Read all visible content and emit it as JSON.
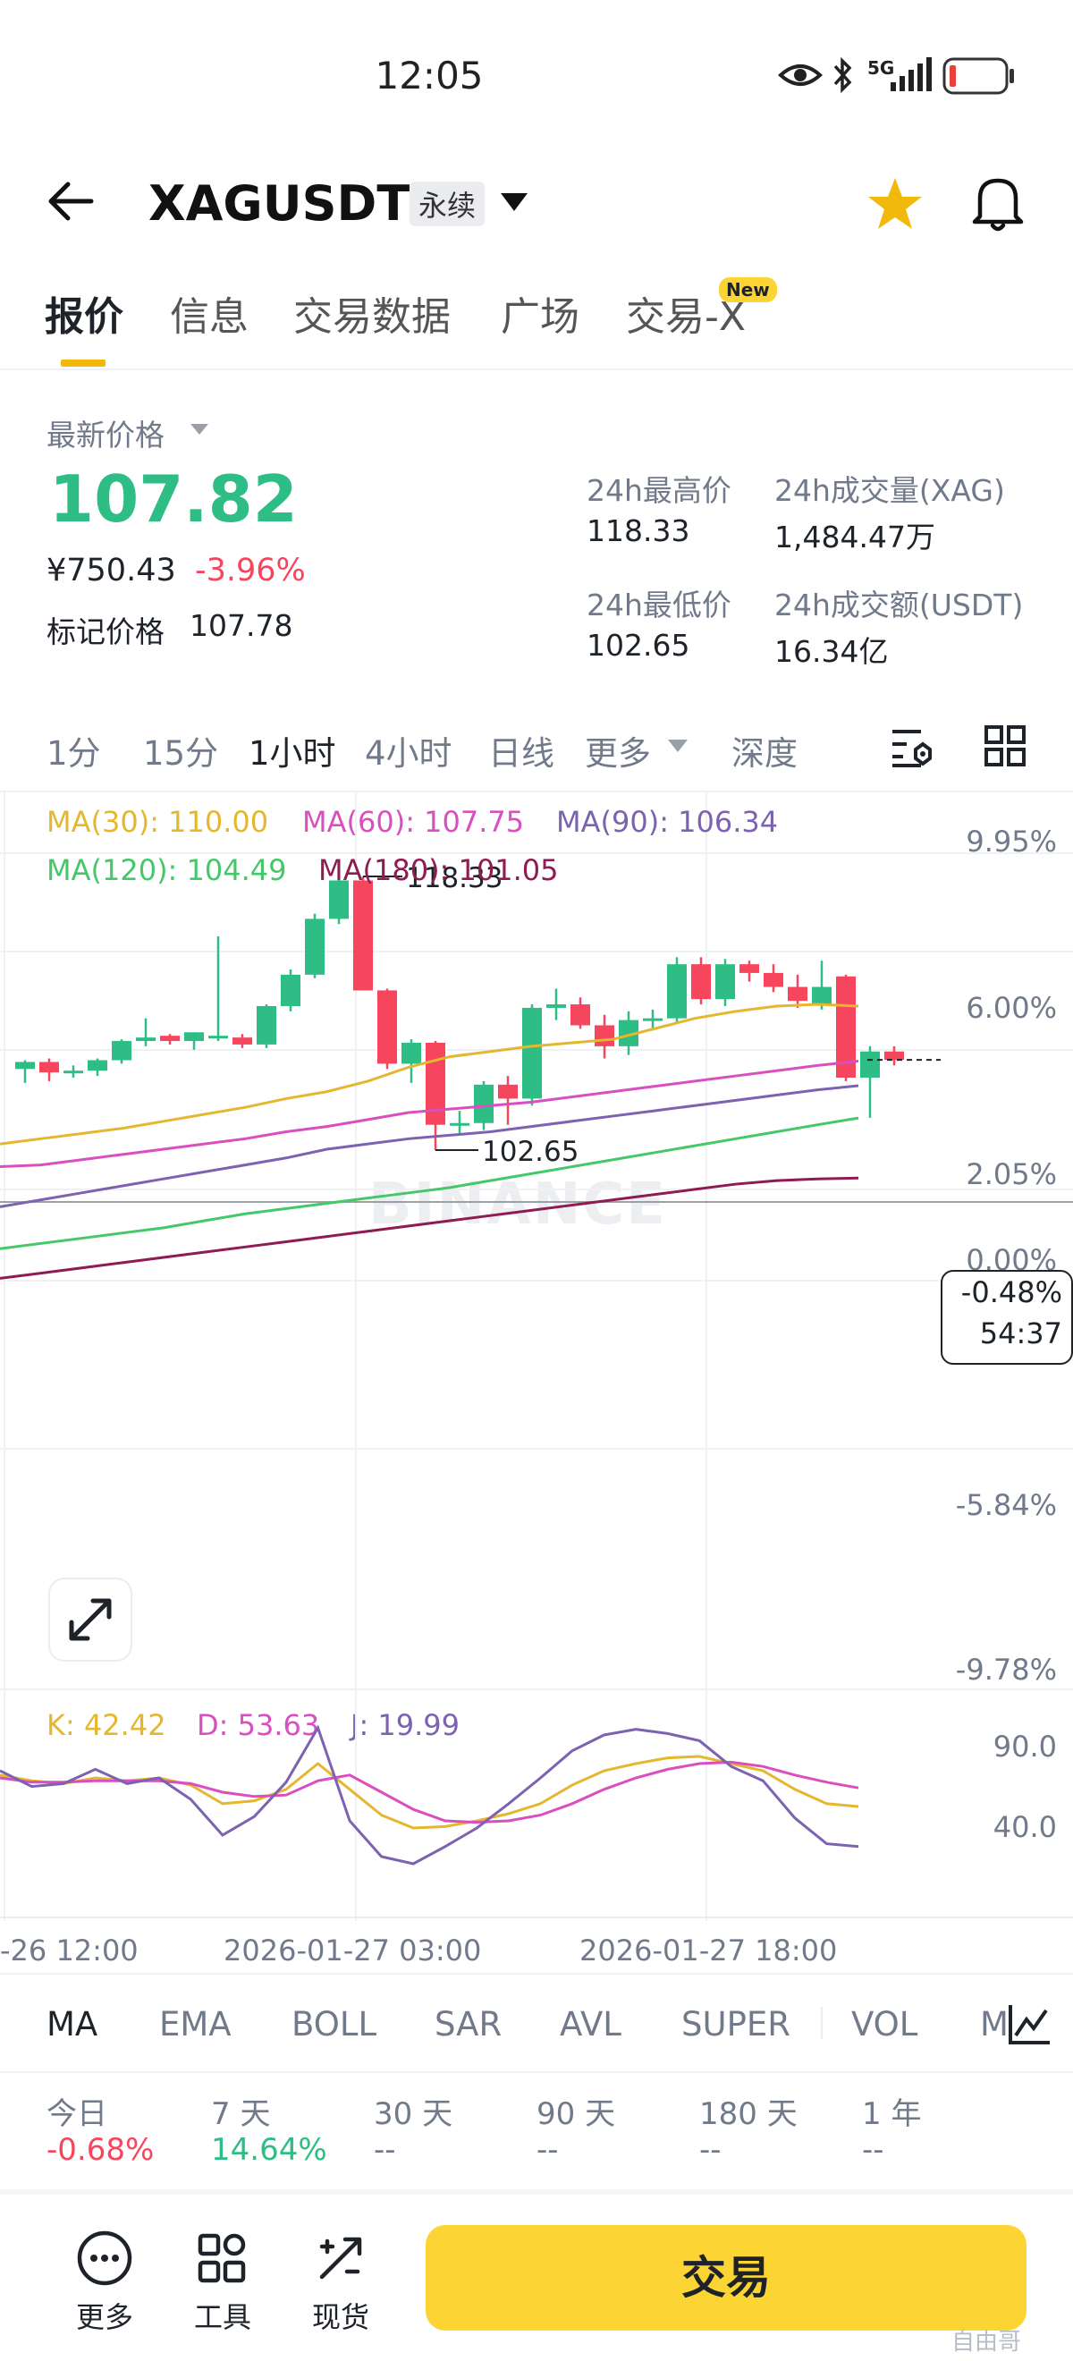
{
  "status_bar": {
    "time": "12:05",
    "network": "5G"
  },
  "header": {
    "symbol": "XAGUSDT",
    "contract_type": "永续"
  },
  "tabs": [
    {
      "label": "报价",
      "active": true
    },
    {
      "label": "信息"
    },
    {
      "label": "交易数据"
    },
    {
      "label": "广场"
    },
    {
      "label": "交易-X",
      "badge": "New"
    }
  ],
  "price": {
    "label": "最新价格",
    "last": "107.82",
    "cny": "¥750.43",
    "change_pct": "-3.96%",
    "mark_label": "标记价格",
    "mark_value": "107.78"
  },
  "stats": {
    "high_label": "24h最高价",
    "high": "118.33",
    "vol_label": "24h成交量(XAG)",
    "vol": "1,484.47万",
    "low_label": "24h最低价",
    "low": "102.65",
    "turnover_label": "24h成交额(USDT)",
    "turnover": "16.34亿"
  },
  "intervals": [
    "1分",
    "15分",
    "1小时",
    "4小时",
    "日线",
    "更多",
    "深度"
  ],
  "active_interval": "1小时",
  "ma_legend": {
    "ma30": "MA(30): 110.00",
    "ma60": "MA(60): 107.75",
    "ma90": "MA(90): 106.34",
    "ma120": "MA(120): 104.49",
    "ma180": "MA(180): 101.05"
  },
  "chart_annotations": {
    "high": "118.33",
    "low": "102.65"
  },
  "current_change": "-0.48%",
  "countdown": "54:37",
  "watermark": "BINANCE",
  "kdj_legend": {
    "k": "K: 42.42",
    "d": "D: 53.63",
    "j": "J: 19.99"
  },
  "colors": {
    "up": "#2ebd85",
    "down": "#f6465d",
    "ma30": "#e5b72f",
    "ma60": "#d94fbf",
    "ma90": "#7c62b0",
    "ma120": "#45c86a",
    "ma180": "#8e1c52",
    "accent": "#fcd535"
  },
  "chart_data": [
    {
      "type": "candlestick",
      "y_axis_labels": [
        "9.95%",
        "6.00%",
        "2.05%",
        "0.00%",
        "-5.84%",
        "-9.78%"
      ],
      "x_axis_labels": [
        "-26 12:00",
        "2026-01-27 03:00",
        "2026-01-27 18:00"
      ],
      "candles": [
        {
          "o": 107.3,
          "h": 107.8,
          "l": 106.5,
          "c": 107.7
        },
        {
          "o": 107.7,
          "h": 107.9,
          "l": 106.6,
          "c": 107.1
        },
        {
          "o": 107.1,
          "h": 107.5,
          "l": 106.8,
          "c": 107.2
        },
        {
          "o": 107.2,
          "h": 107.9,
          "l": 106.9,
          "c": 107.8
        },
        {
          "o": 107.8,
          "h": 109.0,
          "l": 107.6,
          "c": 108.9
        },
        {
          "o": 108.9,
          "h": 110.2,
          "l": 108.6,
          "c": 109.1
        },
        {
          "o": 109.2,
          "h": 109.3,
          "l": 108.7,
          "c": 108.9
        },
        {
          "o": 108.9,
          "h": 109.4,
          "l": 108.4,
          "c": 109.4
        },
        {
          "o": 109.1,
          "h": 114.9,
          "l": 108.9,
          "c": 109.2
        },
        {
          "o": 109.1,
          "h": 109.3,
          "l": 108.5,
          "c": 108.7
        },
        {
          "o": 108.7,
          "h": 111.0,
          "l": 108.5,
          "c": 110.9
        },
        {
          "o": 110.9,
          "h": 113.0,
          "l": 110.6,
          "c": 112.7
        },
        {
          "o": 112.7,
          "h": 116.2,
          "l": 112.5,
          "c": 115.9
        },
        {
          "o": 115.9,
          "h": 118.3,
          "l": 115.6,
          "c": 118.1
        },
        {
          "o": 118.1,
          "h": 118.33,
          "l": 111.8,
          "c": 111.8
        },
        {
          "o": 111.8,
          "h": 111.9,
          "l": 107.3,
          "c": 107.6
        },
        {
          "o": 107.6,
          "h": 109.0,
          "l": 106.5,
          "c": 108.8
        },
        {
          "o": 108.8,
          "h": 108.9,
          "l": 102.65,
          "c": 104.1
        },
        {
          "o": 104.1,
          "h": 104.9,
          "l": 103.6,
          "c": 104.2
        },
        {
          "o": 104.2,
          "h": 106.6,
          "l": 103.8,
          "c": 106.4
        },
        {
          "o": 106.4,
          "h": 106.9,
          "l": 104.1,
          "c": 105.6
        },
        {
          "o": 105.6,
          "h": 111.0,
          "l": 105.2,
          "c": 110.8
        },
        {
          "o": 110.8,
          "h": 111.9,
          "l": 110.1,
          "c": 111.0
        },
        {
          "o": 111.0,
          "h": 111.4,
          "l": 109.6,
          "c": 109.8
        },
        {
          "o": 109.8,
          "h": 110.4,
          "l": 107.9,
          "c": 108.6
        },
        {
          "o": 108.6,
          "h": 110.6,
          "l": 108.1,
          "c": 110.1
        },
        {
          "o": 110.1,
          "h": 110.7,
          "l": 109.5,
          "c": 110.2
        },
        {
          "o": 110.2,
          "h": 113.7,
          "l": 109.9,
          "c": 113.3
        },
        {
          "o": 113.3,
          "h": 113.7,
          "l": 111.0,
          "c": 111.3
        },
        {
          "o": 111.3,
          "h": 113.6,
          "l": 110.9,
          "c": 113.3
        },
        {
          "o": 113.3,
          "h": 113.5,
          "l": 112.3,
          "c": 112.8
        },
        {
          "o": 112.8,
          "h": 113.3,
          "l": 111.7,
          "c": 112.0
        },
        {
          "o": 112.0,
          "h": 112.7,
          "l": 110.8,
          "c": 111.2
        },
        {
          "o": 111.0,
          "h": 113.5,
          "l": 110.7,
          "c": 112.0
        },
        {
          "o": 112.6,
          "h": 112.7,
          "l": 106.6,
          "c": 106.8
        },
        {
          "o": 106.8,
          "h": 108.6,
          "l": 104.5,
          "c": 108.3
        },
        {
          "o": 108.3,
          "h": 108.6,
          "l": 107.5,
          "c": 107.82
        }
      ],
      "moving_averages": [
        {
          "name": "MA(30)",
          "values": [
            103.0,
            103.3,
            103.6,
            103.9,
            104.3,
            104.7,
            105.1,
            105.6,
            106.0,
            106.6,
            107.4,
            108.0,
            108.3,
            108.6,
            108.8,
            109.0,
            109.6,
            110.2,
            110.6,
            110.9,
            111.0,
            110.9
          ]
        },
        {
          "name": "MA(60)",
          "values": [
            101.7,
            101.8,
            102.1,
            102.4,
            102.7,
            103.0,
            103.3,
            103.7,
            104.0,
            104.4,
            104.8,
            105.0,
            105.2,
            105.4,
            105.7,
            106.0,
            106.3,
            106.6,
            106.9,
            107.2,
            107.5,
            107.75
          ]
        },
        {
          "name": "MA(90)",
          "values": [
            99.4,
            99.8,
            100.2,
            100.6,
            101.0,
            101.4,
            101.8,
            102.2,
            102.7,
            103.0,
            103.3,
            103.5,
            103.7,
            104.0,
            104.3,
            104.6,
            104.9,
            105.2,
            105.5,
            105.8,
            106.1,
            106.34
          ]
        },
        {
          "name": "MA(120)",
          "values": [
            97.0,
            97.3,
            97.6,
            97.9,
            98.2,
            98.6,
            99.0,
            99.3,
            99.6,
            99.9,
            100.2,
            100.5,
            100.9,
            101.3,
            101.7,
            102.1,
            102.5,
            102.9,
            103.3,
            103.7,
            104.1,
            104.49
          ]
        },
        {
          "name": "MA(180)",
          "values": [
            95.3,
            95.6,
            95.9,
            96.2,
            96.5,
            96.8,
            97.1,
            97.4,
            97.7,
            98.0,
            98.3,
            98.6,
            98.9,
            99.2,
            99.5,
            99.8,
            100.1,
            100.4,
            100.7,
            100.9,
            101.0,
            101.05
          ]
        }
      ]
    },
    {
      "type": "line",
      "y_axis_labels": [
        "90.0",
        "40.0"
      ],
      "series": [
        {
          "name": "K",
          "values": [
            62,
            58,
            56,
            60,
            58,
            60,
            55,
            42,
            44,
            52,
            70,
            52,
            34,
            25,
            26,
            30,
            35,
            42,
            55,
            65,
            70,
            74,
            75,
            70,
            65,
            52,
            42,
            40
          ]
        },
        {
          "name": "D",
          "values": [
            60,
            57,
            57,
            58,
            58,
            58,
            56,
            50,
            47,
            48,
            58,
            62,
            50,
            38,
            30,
            29,
            30,
            34,
            42,
            52,
            60,
            66,
            70,
            71,
            68,
            62,
            57,
            53
          ]
        },
        {
          "name": "J",
          "values": [
            65,
            54,
            56,
            66,
            56,
            60,
            45,
            20,
            33,
            57,
            95,
            30,
            5,
            0,
            12,
            25,
            42,
            60,
            79,
            90,
            94,
            91,
            86,
            68,
            58,
            32,
            14,
            12
          ]
        }
      ]
    }
  ],
  "indicator_tabs": [
    "MA",
    "EMA",
    "BOLL",
    "SAR",
    "AVL",
    "SUPER",
    "VOL",
    "M"
  ],
  "active_indicator": "MA",
  "performance": [
    {
      "label": "今日",
      "value": "-0.68%"
    },
    {
      "label": "7 天",
      "value": "14.64%"
    },
    {
      "label": "30 天",
      "value": "--"
    },
    {
      "label": "90 天",
      "value": "--"
    },
    {
      "label": "180 天",
      "value": "--"
    },
    {
      "label": "1 年",
      "value": "--"
    }
  ],
  "bottom_bar": {
    "more": "更多",
    "tools": "工具",
    "spot": "现货",
    "trade": "交易"
  },
  "corner_watermark": "自由哥"
}
